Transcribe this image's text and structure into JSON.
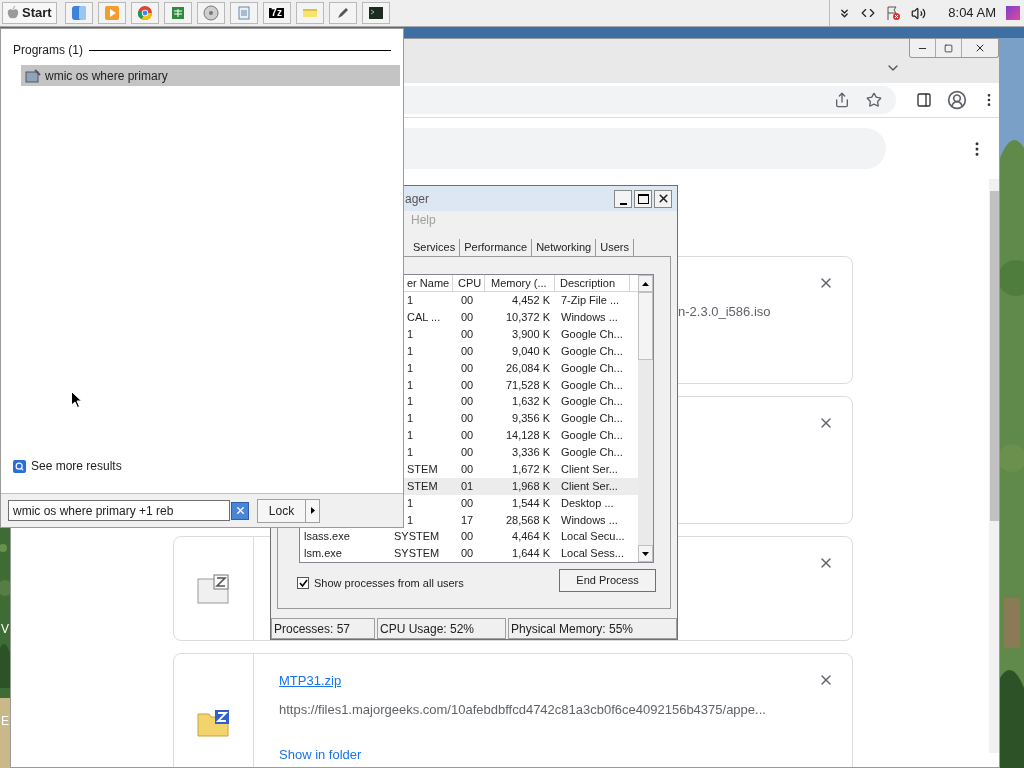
{
  "taskbar": {
    "start_label": "Start",
    "apps": [
      {
        "kind": "finder"
      },
      {
        "kind": "media"
      },
      {
        "kind": "browser"
      },
      {
        "kind": "sheet"
      },
      {
        "kind": "disc"
      },
      {
        "kind": "notepad"
      },
      {
        "kind": "archive",
        "label": "7z"
      },
      {
        "kind": "note"
      },
      {
        "kind": "pen"
      },
      {
        "kind": "terminal"
      }
    ],
    "clock": "8:04 AM"
  },
  "desktop_labels": [
    "V",
    "E"
  ],
  "browser": {
    "downloads": [
      {
        "kind": "partial",
        "file_tail": "n-2.3.0_i586.iso"
      },
      {
        "kind": "blank"
      },
      {
        "kind": "icon-only"
      },
      {
        "kind": "full",
        "name": "MTP31.zip",
        "url": "https://files1.majorgeeks.com/10afebdbffcd4742c81a3cb0f6ce4092156b4375/appe...",
        "action": "Show in folder"
      }
    ]
  },
  "task_manager": {
    "title": "ager",
    "menu": [
      "Help"
    ],
    "tabs": [
      {
        "label": "Services",
        "selected": false
      },
      {
        "label": "Performance",
        "selected": false
      },
      {
        "label": "Networking",
        "selected": false
      },
      {
        "label": "Users",
        "selected": false
      }
    ],
    "columns": [
      "er Name",
      "CPU",
      "Memory (...",
      "Description"
    ],
    "rows": [
      {
        "user": "1",
        "cpu": "00",
        "memory": "4,452 K",
        "description": "7-Zip File ...",
        "selected": false
      },
      {
        "user": "CAL ...",
        "cpu": "00",
        "memory": "10,372 K",
        "description": "Windows ...",
        "selected": false
      },
      {
        "user": "1",
        "cpu": "00",
        "memory": "3,900 K",
        "description": "Google Ch...",
        "selected": false
      },
      {
        "user": "1",
        "cpu": "00",
        "memory": "9,040 K",
        "description": "Google Ch...",
        "selected": false
      },
      {
        "user": "1",
        "cpu": "00",
        "memory": "26,084 K",
        "description": "Google Ch...",
        "selected": false
      },
      {
        "user": "1",
        "cpu": "00",
        "memory": "71,528 K",
        "description": "Google Ch...",
        "selected": false
      },
      {
        "user": "1",
        "cpu": "00",
        "memory": "1,632 K",
        "description": "Google Ch...",
        "selected": false
      },
      {
        "user": "1",
        "cpu": "00",
        "memory": "9,356 K",
        "description": "Google Ch...",
        "selected": false
      },
      {
        "user": "1",
        "cpu": "00",
        "memory": "14,128 K",
        "description": "Google Ch...",
        "selected": false
      },
      {
        "user": "1",
        "cpu": "00",
        "memory": "3,336 K",
        "description": "Google Ch...",
        "selected": false
      },
      {
        "user": "STEM",
        "cpu": "00",
        "memory": "1,672 K",
        "description": "Client Ser...",
        "selected": false
      },
      {
        "user": "STEM",
        "cpu": "01",
        "memory": "1,968 K",
        "description": "Client Ser...",
        "selected": true
      },
      {
        "user": "1",
        "cpu": "00",
        "memory": "1,544 K",
        "description": "Desktop ...",
        "selected": false
      },
      {
        "user": "1",
        "cpu": "17",
        "memory": "28,568 K",
        "description": "Windows ...",
        "selected": false
      },
      {
        "name": "lsass.exe",
        "user": "SYSTEM",
        "cpu": "00",
        "memory": "4,464 K",
        "description": "Local Secu...",
        "selected": false
      },
      {
        "name": "lsm.exe",
        "user": "SYSTEM",
        "cpu": "00",
        "memory": "1,644 K",
        "description": "Local Sess...",
        "selected": false
      }
    ],
    "show_all": {
      "label": "Show processes from all users",
      "checked": true
    },
    "end_button": "End Process",
    "status": [
      "Processes: 57",
      "CPU Usage: 52%",
      "Physical Memory: 55%"
    ]
  },
  "start_menu": {
    "section": "Programs (1)",
    "results": [
      {
        "label": "wmic os where primary",
        "selected": true
      }
    ],
    "more": "See more results",
    "search_value": "wmic os where primary +1 reb",
    "power_button": "Lock"
  }
}
